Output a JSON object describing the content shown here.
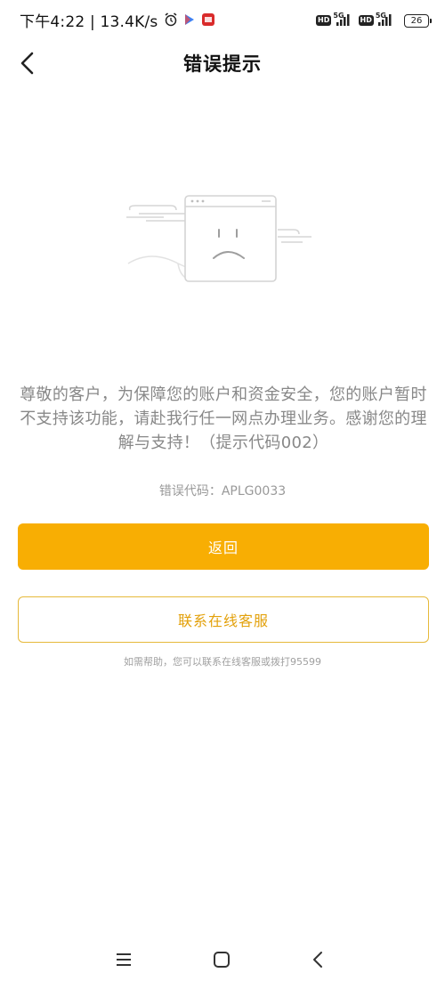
{
  "status_bar": {
    "time": "下午4:22 | 13.4K/s",
    "hd_badge": "HD",
    "network": "5G",
    "battery": "26"
  },
  "nav": {
    "title": "错误提示"
  },
  "illustration": {
    "face": "sad"
  },
  "message": "尊敬的客户，为保障您的账户和资金安全，您的账户暂时不支持该功能，请赴我行任一网点办理业务。感谢您的理解与支持！（提示代码002）",
  "error_code": "错误代码：APLG0033",
  "buttons": {
    "return_label": "返回",
    "contact_label": "联系在线客服"
  },
  "help_text": "如需帮助，您可以联系在线客服或拨打95599",
  "colors": {
    "primary": "#f8ae03",
    "outline_border": "#e6b93a",
    "outline_text": "#e3a10b",
    "message_text": "#888888"
  }
}
